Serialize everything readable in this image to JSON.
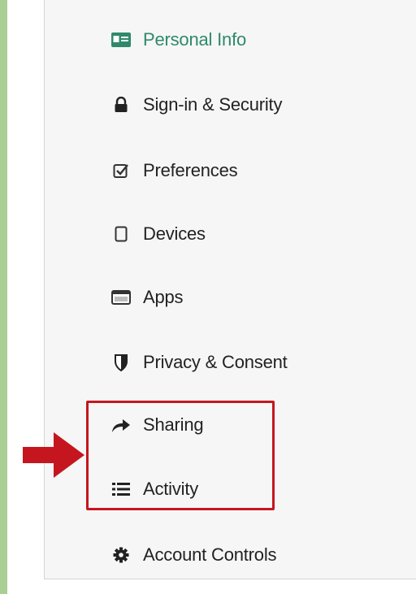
{
  "sidebar": {
    "items": [
      {
        "label": "Personal Info",
        "icon": "id-card-icon",
        "active": true
      },
      {
        "label": "Sign-in & Security",
        "icon": "lock-icon"
      },
      {
        "label": "Preferences",
        "icon": "checkbox-icon"
      },
      {
        "label": "Devices",
        "icon": "device-icon"
      },
      {
        "label": "Apps",
        "icon": "apps-window-icon"
      },
      {
        "label": "Privacy & Consent",
        "icon": "shield-icon"
      },
      {
        "label": "Sharing",
        "icon": "share-arrow-icon"
      },
      {
        "label": "Activity",
        "icon": "list-icon"
      },
      {
        "label": "Account Controls",
        "icon": "gear-icon"
      }
    ]
  },
  "annotation": {
    "highlight_color": "#c5161f",
    "highlighted_items": [
      "Sharing",
      "Activity"
    ]
  },
  "colors": {
    "active": "#2e8a6a",
    "text": "#222222",
    "rail": "#a9cf95",
    "panel": "#f6f6f6"
  }
}
